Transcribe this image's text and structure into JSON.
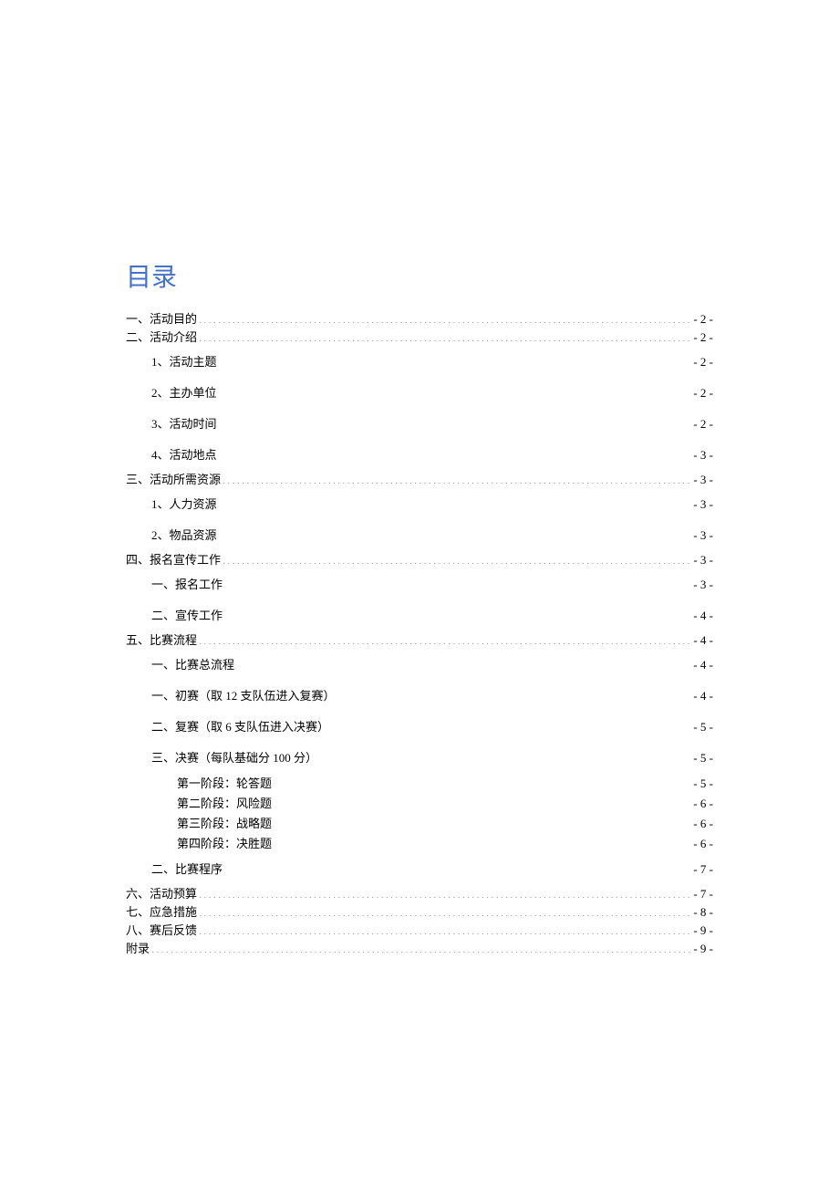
{
  "title": "目录",
  "entries": [
    {
      "text": "一、活动目的",
      "page": "- 2 -",
      "level": 0,
      "tight": true
    },
    {
      "text": "二、活动介绍",
      "page": "- 2 -",
      "level": 0,
      "tight": true
    },
    {
      "text": "1、活动主题",
      "page": "- 2 -",
      "level": 1
    },
    {
      "text": "2、主办单位",
      "page": "- 2 -",
      "level": 1
    },
    {
      "text": "3、活动时间",
      "page": "- 2 -",
      "level": 1
    },
    {
      "text": "4、活动地点",
      "page": "- 3 -",
      "level": 1
    },
    {
      "text": "三、活动所需资源",
      "page": "- 3 -",
      "level": 0
    },
    {
      "text": "1、人力资源",
      "page": "- 3 -",
      "level": 1
    },
    {
      "text": "2、物品资源",
      "page": "- 3 -",
      "level": 1
    },
    {
      "text": "四、报名宣传工作",
      "page": "- 3 -",
      "level": 0
    },
    {
      "text": "一、报名工作",
      "page": "- 3 -",
      "level": 1
    },
    {
      "text": "二、宣传工作",
      "page": "- 4 -",
      "level": 1
    },
    {
      "text": "五、比赛流程",
      "page": "- 4 -",
      "level": 0
    },
    {
      "text": "一、比赛总流程",
      "page": "- 4 -",
      "level": 1
    },
    {
      "text": "一、初赛（取 12 支队伍进入复赛）",
      "page": "- 4 -",
      "level": 1
    },
    {
      "text": "二、复赛（取 6 支队伍进入决赛）",
      "page": "- 5 -",
      "level": 1
    },
    {
      "text": "三、决赛（每队基础分 100 分）",
      "page": "- 5 -",
      "level": 1
    },
    {
      "text": "第一阶段：轮答题",
      "page": "- 5 -",
      "level": 2
    },
    {
      "text": "第二阶段：风险题",
      "page": "- 6 -",
      "level": 2
    },
    {
      "text": "第三阶段：战略题",
      "page": "- 6 -",
      "level": 2
    },
    {
      "text": "第四阶段：决胜题",
      "page": "- 6 -",
      "level": 2
    },
    {
      "text": "二、比赛程序",
      "page": "- 7 -",
      "level": 1
    },
    {
      "text": "六、活动预算",
      "page": "- 7 -",
      "level": 0
    },
    {
      "text": "七、应急措施",
      "page": "- 8 -",
      "level": 0
    },
    {
      "text": "八、赛后反馈",
      "page": "- 9 -",
      "level": 0
    },
    {
      "text": "附录",
      "page": "- 9 -",
      "level": 0
    }
  ]
}
